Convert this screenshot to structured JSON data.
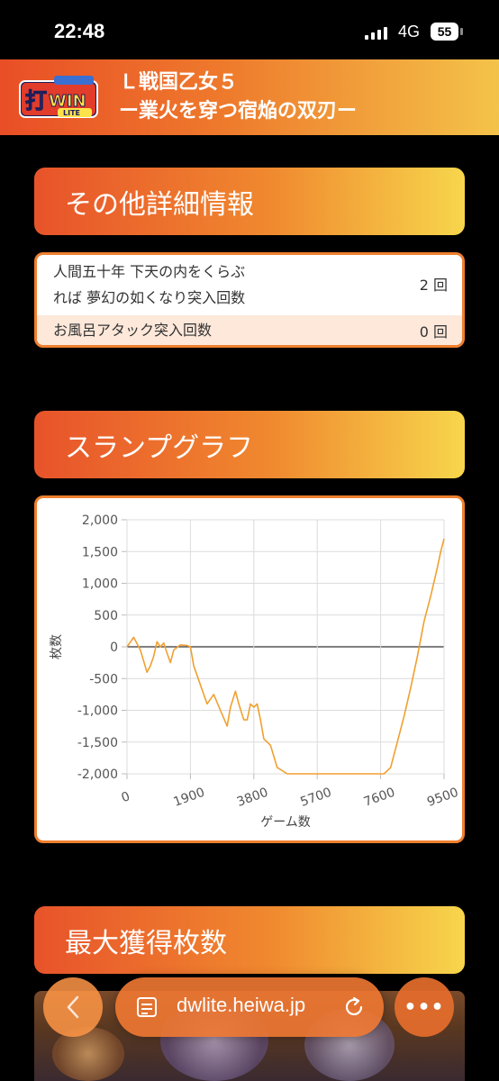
{
  "status_bar": {
    "time": "22:48",
    "network": "4G",
    "battery": "55"
  },
  "header": {
    "logo_text": "打WIN LITE",
    "title_line1": "Ｌ戦国乙女５",
    "title_line2": "ー業火を穿つ宿焔の双刃ー"
  },
  "details": {
    "heading": "その他詳細情報",
    "rows": [
      {
        "label": "人間五十年 下天の内をくらぶ\nれば 夢幻の如くなり突入回数",
        "value": "2 回"
      },
      {
        "label": "お風呂アタック突入回数",
        "value": "0 回"
      }
    ]
  },
  "slump": {
    "heading": "スランプグラフ"
  },
  "max": {
    "heading": "最大獲得枚数"
  },
  "browser": {
    "url": "dwlite.heiwa.jp"
  },
  "colors": {
    "accent": "#ef7f2e",
    "line": "#f0a030",
    "header_start": "#e94e26",
    "header_end": "#f4c349"
  },
  "chart_data": {
    "type": "line",
    "xlabel": "ゲーム数",
    "ylabel": "枚数",
    "xlim": [
      0,
      9500
    ],
    "ylim": [
      -2000,
      2000
    ],
    "x_ticks": [
      "0",
      "1900",
      "3800",
      "5700",
      "7600",
      "9500"
    ],
    "y_ticks": [
      "2,000",
      "1,500",
      "1,000",
      "500",
      "0",
      "-500",
      "-1,000",
      "-1,500",
      "-2,000"
    ],
    "grid": true,
    "series": [
      {
        "x": [
          0,
          200,
          400,
          600,
          700,
          800,
          900,
          1000,
          1100,
          1200,
          1300,
          1400,
          1600,
          1800,
          1900,
          2000,
          2200,
          2400,
          2600,
          2800,
          3000,
          3100,
          3250,
          3350,
          3500,
          3600,
          3700,
          3800,
          3900,
          4000,
          4100,
          4300,
          4500,
          4800,
          5200,
          6000,
          7000,
          7700,
          7900,
          8100,
          8300,
          8500,
          8700,
          8900,
          9100,
          9300,
          9400,
          9500
        ],
        "values": [
          0,
          150,
          -50,
          -400,
          -300,
          -150,
          80,
          0,
          60,
          -100,
          -250,
          -50,
          30,
          20,
          0,
          -300,
          -600,
          -900,
          -750,
          -1000,
          -1250,
          -950,
          -700,
          -900,
          -1150,
          -1150,
          -900,
          -950,
          -900,
          -1150,
          -1450,
          -1550,
          -1900,
          -2000,
          -2000,
          -2000,
          -2000,
          -2000,
          -1900,
          -1500,
          -1100,
          -650,
          -150,
          400,
          800,
          1250,
          1500,
          1700
        ]
      }
    ]
  }
}
